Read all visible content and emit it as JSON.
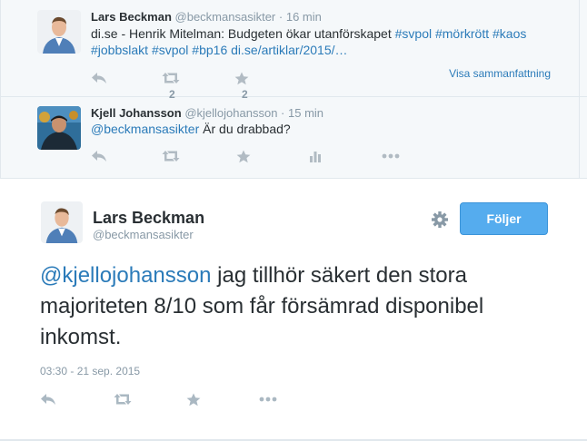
{
  "conversation": [
    {
      "name": "Lars Beckman",
      "handle": "@beckmansasikter",
      "separator": "·",
      "time": "16 min",
      "text_plain": "di.se - Henrik Mitelman: Budgeten ökar utanförskapet ",
      "hashtags_line1": [
        "#svpol",
        "#mörkrött",
        "#kaos"
      ],
      "hashtags_line2": [
        "#jobbslakt",
        "#svpol",
        "#bp16"
      ],
      "link": "di.se/artiklar/2015/…",
      "retweet_count": "2",
      "favorite_count": "2",
      "summary_link": "Visa sammanfattning"
    },
    {
      "name": "Kjell Johansson",
      "handle": "@kjellojohansson",
      "separator": "·",
      "time": "15 min",
      "mention": "@beckmansasikter",
      "text_rest": " Är du drabbad?"
    }
  ],
  "main_tweet": {
    "name": "Lars Beckman",
    "handle": "@beckmansasikter",
    "follow_label": "Följer",
    "mention": "@kjellojohansson",
    "text_rest": " jag tillhör säkert den stora majoriteten 8/10 som får försämrad disponibel inkomst.",
    "timestamp": "03:30 - 21 sep. 2015"
  },
  "icons": [
    "reply-icon",
    "retweet-icon",
    "star-icon",
    "stats-icon",
    "more-icon",
    "gear-icon"
  ],
  "colors": {
    "link": "#2b7bb9",
    "follow_button": "#55acee",
    "muted": "#8899a6",
    "conversation_bg": "#f5f8fa"
  }
}
